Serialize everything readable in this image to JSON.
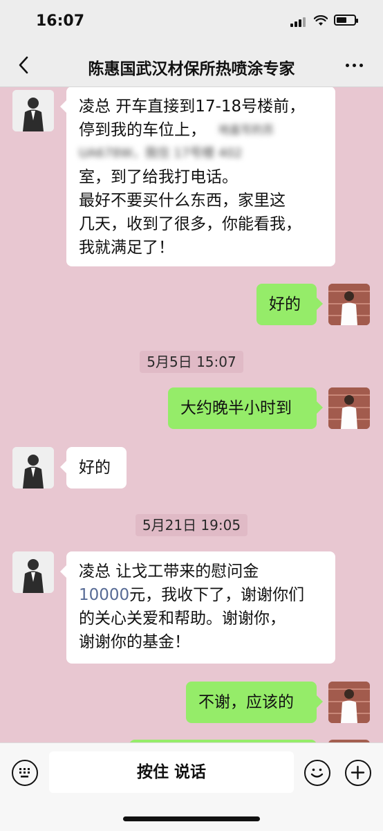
{
  "status_bar": {
    "time": "16:07"
  },
  "header": {
    "title": "陈惠国武汉材保所热喷涂专家"
  },
  "messages": [
    {
      "lines": [
        "凌总 开车直接到17-18号楼前，",
        "停到我的车位上，"
      ]
    },
    {
      "blurred": [
        "地盖写的苏",
        "UA678W，我住 17号楼 402"
      ]
    },
    {
      "lines_after": [
        "室，到了给我打电话。",
        "最好不要买什么东西，家里这",
        "几天，收到了很多，你能看我，",
        "我就满足了！"
      ]
    },
    {
      "text": "好的"
    },
    {
      "timestamp": "5月5日 15:07"
    },
    {
      "text": "大约晚半小时到"
    },
    {
      "text": "好的"
    },
    {
      "timestamp": "5月21日 19:05"
    },
    {
      "line1": "凌总 让戈工带来的慰问金",
      "amount": "10000",
      "line2_rest": "元，我收下了，谢谢你们",
      "line3": "的关心关爱和帮助。谢谢你，",
      "line4": "谢谢你的基金！"
    },
    {
      "text": "不谢，应该的"
    }
  ],
  "input": {
    "talk_label": "按住 说话",
    "keyboard_icon": "keyboard-icon",
    "emoji_icon": "emoji-icon",
    "plus_icon": "plus-icon"
  }
}
